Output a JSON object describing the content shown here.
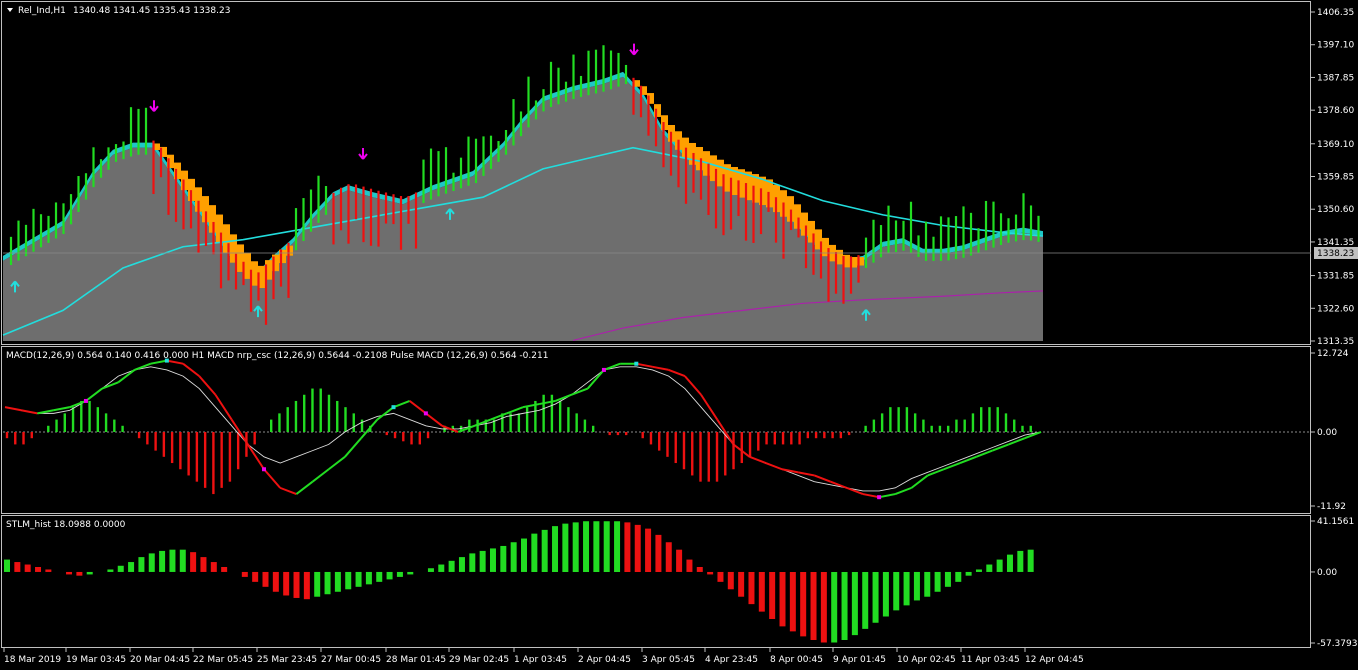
{
  "window": {
    "menu_icon": "triangle-down-icon",
    "symbol_header": "Rel_Ind,H1",
    "ohlc_header": "1340.48 1341.45 1335.43 1338.23"
  },
  "colors": {
    "background": "#000000",
    "grid_frame": "#c0c0c0",
    "price_area": "#6e6e6e",
    "up_bar": "#22dd22",
    "down_bar": "#ee1111",
    "cyan": "#22dddd",
    "orange": "#ffa000",
    "magenta": "#ee00ee",
    "purple": "#aa22aa",
    "macd_signal": "#dddddd"
  },
  "chart_data": [
    {
      "type": "line",
      "panel": "price",
      "indicator_label": "Rel_Ind,H1",
      "current_price_label": "1338.23",
      "ylim": [
        1313.35,
        1406.35
      ],
      "y_ticks": [
        "1406.35",
        "1397.10",
        "1387.85",
        "1378.60",
        "1369.10",
        "1359.85",
        "1350.60",
        "1341.35",
        "1331.85",
        "1322.60",
        "1313.35"
      ],
      "x_tick_labels": [
        "18 Mar 2019",
        "19 Mar 03:45",
        "20 Mar 04:45",
        "22 Mar 05:45",
        "25 Mar 23:45",
        "27 Mar 00:45",
        "28 Mar 01:45",
        "29 Mar 02:45",
        "1 Apr 03:45",
        "2 Apr 04:45",
        "3 Apr 05:45",
        "4 Apr 23:45",
        "8 Apr 00:45",
        "9 Apr 01:45",
        "10 Apr 02:45",
        "11 Apr 03:45",
        "12 Apr 04:45"
      ],
      "series": [
        {
          "values_x": [
            0,
            30,
            60,
            90,
            110,
            130,
            150,
            155,
            170,
            190,
            210,
            230,
            250,
            270,
            290,
            310,
            330,
            345,
            370,
            400,
            430,
            470,
            500,
            520,
            540,
            570,
            600,
            620,
            640,
            660,
            680,
            700,
            720,
            740,
            760,
            780,
            800,
            820,
            840,
            860,
            880,
            900,
            920,
            940,
            960,
            980,
            1000,
            1020,
            1040
          ],
          "values": [
            1336,
            1341,
            1346,
            1360,
            1366,
            1368,
            1368,
            1366,
            1360,
            1352,
            1344,
            1336,
            1330,
            1336,
            1341,
            1348,
            1354,
            1356,
            1354,
            1352,
            1356,
            1360,
            1368,
            1375,
            1381,
            1384,
            1386,
            1388,
            1382,
            1372,
            1366,
            1362,
            1358,
            1356,
            1354,
            1350,
            1344,
            1338,
            1335,
            1336,
            1340,
            1341,
            1338,
            1338,
            1339,
            1341,
            1343,
            1344,
            1343
          ]
        }
      ],
      "signals": [
        {
          "kind": "up",
          "x_index": 0,
          "price": 1328.5
        },
        {
          "kind": "down",
          "x_index": 1,
          "price": 1380
        },
        {
          "kind": "up",
          "x_index": 2,
          "price": 1321.5
        },
        {
          "kind": "down",
          "x_index": 3,
          "price": 1366.5
        },
        {
          "kind": "up",
          "x_index": 4,
          "price": 1349
        },
        {
          "kind": "down",
          "x_index": 5,
          "price": 1396
        },
        {
          "kind": "up",
          "x_index": 6,
          "price": 1320.5
        }
      ]
    },
    {
      "type": "bar",
      "panel": "macd",
      "indicator_label": "MACD(12,26,9) 0.564 0.140 0.416 0.000  H1 MACD nrp_csc (12,26,9) 0.5644 -0.2108  Pulse MACD (12,26,9) 0.564 -0.211",
      "ylim": [
        -11.92,
        12.724
      ],
      "y_ticks": [
        "12.724",
        "0.00",
        "-11.92"
      ],
      "histogram": [
        -1,
        -2,
        -2,
        -1,
        0,
        1,
        2,
        3,
        4,
        5,
        5,
        4,
        3,
        2,
        1,
        0,
        -1,
        -2,
        -3,
        -4,
        -5,
        -6,
        -7,
        -8,
        -9,
        -10,
        -9,
        -8,
        -6,
        -4,
        -2,
        0,
        2,
        3,
        4,
        5,
        6,
        7,
        7,
        6,
        5,
        4,
        3,
        2,
        1,
        0,
        -0.5,
        -1,
        -1.5,
        -2,
        -2,
        -1,
        0,
        1,
        1,
        1,
        2,
        2,
        2,
        2,
        3,
        3,
        3,
        4,
        5,
        6,
        6,
        5,
        4,
        3,
        2,
        1,
        0,
        -0.5,
        -0.5,
        -0.5,
        0,
        -1,
        -2,
        -3,
        -4,
        -5,
        -6,
        -7,
        -8,
        -8,
        -8,
        -7,
        -6,
        -5,
        -4,
        -3,
        -2,
        -2,
        -2,
        -2,
        -2,
        -1,
        -1,
        -1,
        -1,
        -1,
        -0.5,
        0,
        1,
        2,
        3,
        4,
        4,
        4,
        3,
        2,
        1,
        1,
        1,
        2,
        2,
        3,
        4,
        4,
        4,
        3,
        2,
        1,
        1
      ],
      "macd_line": [
        4,
        3.5,
        3,
        3.5,
        4,
        5,
        7,
        8,
        10,
        11,
        11.5,
        11,
        9,
        6,
        2,
        -2,
        -6,
        -9,
        -10,
        -8,
        -6,
        -4,
        -1,
        2,
        4,
        5,
        3,
        1,
        0,
        1,
        2,
        3,
        4,
        4.5,
        5,
        6,
        7,
        10,
        11,
        11,
        10.5,
        10,
        9,
        6,
        2,
        -2,
        -4,
        -5,
        -6,
        -6.5,
        -7,
        -8,
        -9,
        -10,
        -10.5,
        -10,
        -9,
        -7,
        -6,
        -5,
        -4,
        -3,
        -2,
        -1,
        0
      ],
      "signal_line": [
        4,
        3.5,
        3,
        3,
        3.5,
        5,
        7,
        9,
        10,
        10.5,
        10,
        9,
        7,
        4,
        1,
        -2,
        -4,
        -5,
        -4,
        -3,
        -2,
        0,
        1.5,
        2.5,
        3,
        2,
        1,
        0.5,
        0.5,
        1,
        1.5,
        2.5,
        3,
        3.5,
        4.5,
        6,
        8,
        10,
        10.5,
        10.5,
        10,
        9,
        7,
        4,
        1,
        -2,
        -4,
        -5,
        -6,
        -7,
        -8,
        -8.5,
        -9,
        -9.5,
        -9.5,
        -9,
        -7.5,
        -6.5,
        -5.5,
        -4.5,
        -3.5,
        -2.5,
        -1.5,
        -0.5,
        0
      ]
    },
    {
      "type": "bar",
      "panel": "stlm",
      "indicator_label": "STLM_hist 18.0988 0.0000",
      "ylim": [
        -57.3793,
        41.1561
      ],
      "y_ticks": [
        "41.1561",
        "0.00",
        "-57.3793"
      ],
      "values": [
        10,
        8,
        6,
        4,
        2,
        0,
        -2,
        -3,
        -2,
        0,
        2,
        5,
        8,
        12,
        15,
        17,
        18,
        18,
        16,
        12,
        8,
        4,
        0,
        -4,
        -8,
        -12,
        -16,
        -19,
        -21,
        -22,
        -20,
        -18,
        -16,
        -14,
        -12,
        -10,
        -8,
        -6,
        -4,
        -2,
        0,
        3,
        6,
        9,
        12,
        15,
        17,
        19,
        21,
        24,
        27,
        31,
        34,
        37,
        39,
        40,
        41,
        41,
        41,
        41,
        40,
        38,
        35,
        30,
        24,
        18,
        10,
        4,
        -2,
        -8,
        -14,
        -20,
        -26,
        -32,
        -38,
        -44,
        -48,
        -52,
        -55,
        -57,
        -57,
        -55,
        -51,
        -46,
        -41,
        -36,
        -31,
        -27,
        -23,
        -20,
        -16,
        -12,
        -8,
        -3,
        2,
        6,
        10,
        14,
        17,
        18
      ]
    }
  ]
}
